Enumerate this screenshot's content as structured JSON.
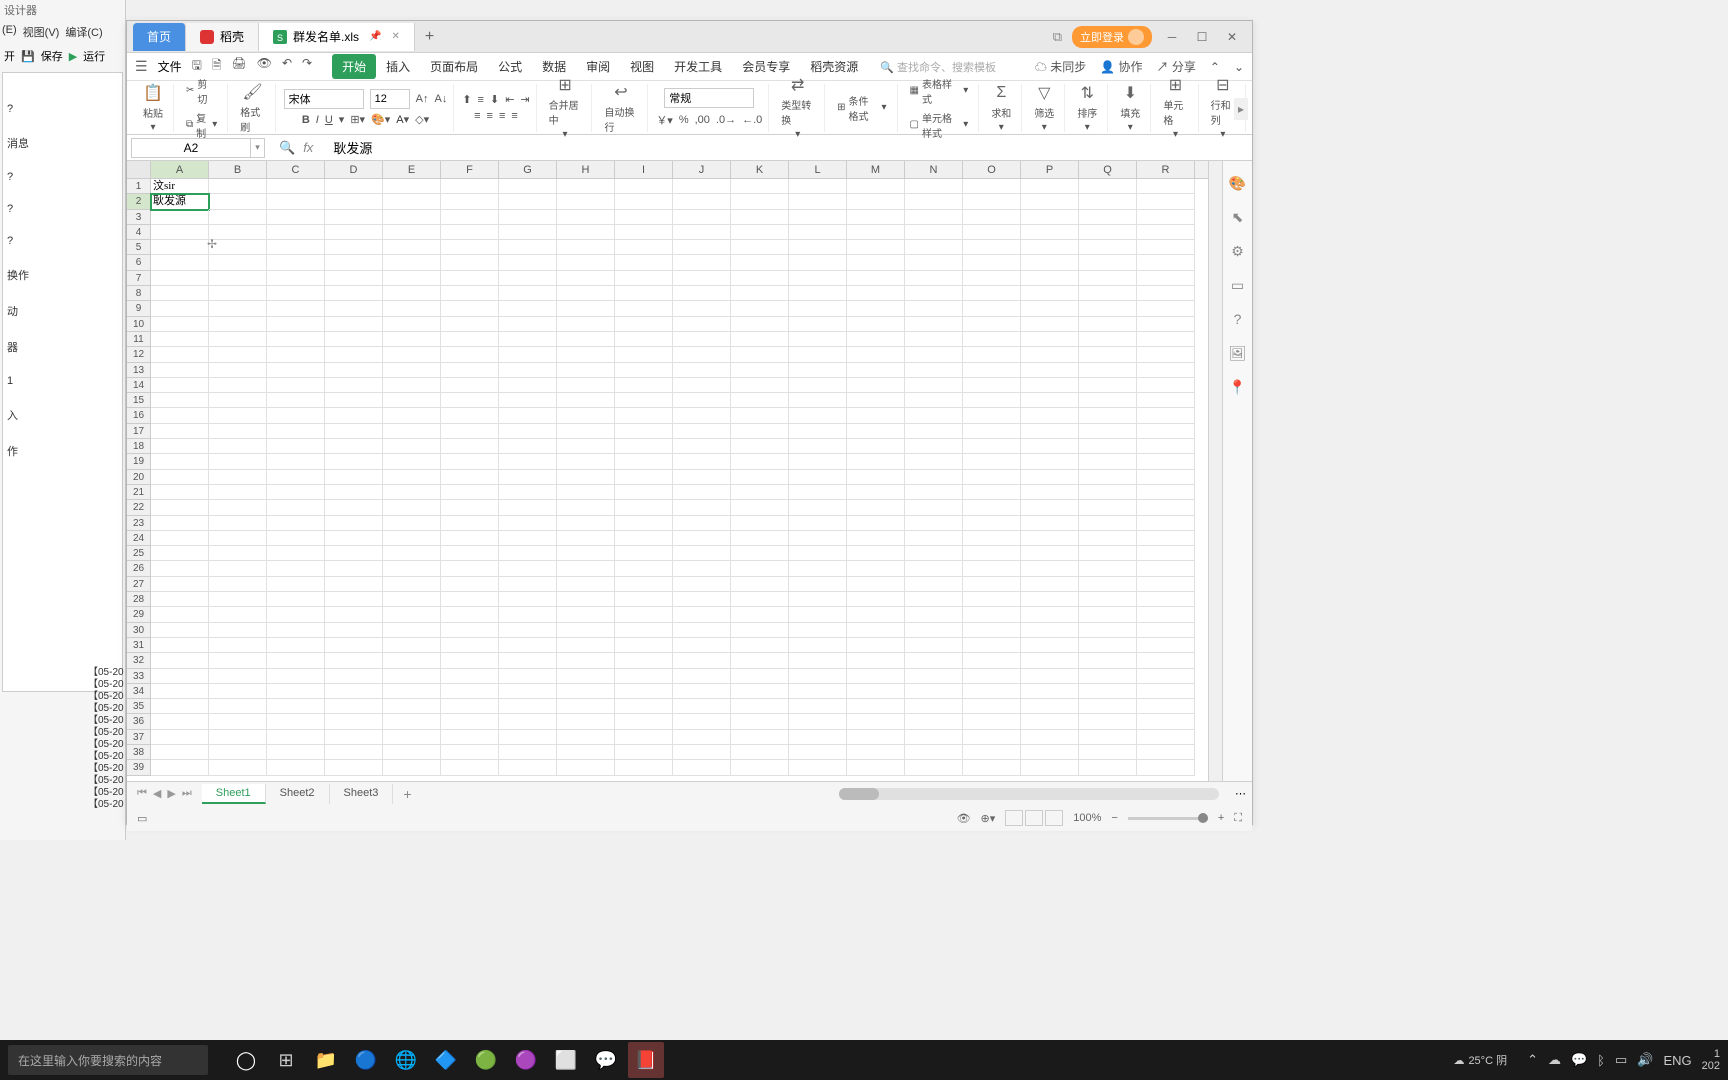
{
  "ide": {
    "title": "设计器",
    "menu": [
      "(E)",
      "视图(V)",
      "编译(C)"
    ],
    "toolbar": {
      "open": "开",
      "save": "保存",
      "run": "运行"
    },
    "tree_items": [
      "?",
      "消息",
      "?",
      "?",
      "?",
      "换作",
      "动",
      "器",
      "1",
      "入",
      "作"
    ],
    "log_lines": [
      "【05-20",
      "【05-20",
      "【05-20",
      "【05-20",
      "【05-20",
      "【05-20",
      "【05-20",
      "【05-20",
      "【05-20",
      "【05-20",
      "【05-20",
      "【05-20"
    ]
  },
  "wps": {
    "tabs": {
      "home": "首页",
      "doc1": "稻壳",
      "current": "群发名单.xls"
    },
    "login": "立即登录",
    "menu": {
      "file": "文件",
      "tabs": [
        "开始",
        "插入",
        "页面布局",
        "公式",
        "数据",
        "审阅",
        "视图",
        "开发工具",
        "会员专享",
        "稻壳资源"
      ],
      "search_placeholder": "查找命令、搜索模板",
      "right": {
        "sync": "未同步",
        "collab": "协作",
        "share": "分享"
      }
    },
    "ribbon": {
      "paste": "粘贴",
      "cut": "剪切",
      "copy": "复制",
      "format_painter": "格式刷",
      "font_name": "宋体",
      "font_size": "12",
      "merge": "合并居中",
      "wrap": "自动换行",
      "number_format": "常规",
      "type_convert": "类型转换",
      "cond_format": "条件格式",
      "table_style": "表格样式",
      "cell_style": "单元格样式",
      "sum": "求和",
      "filter": "筛选",
      "sort": "排序",
      "fill": "填充",
      "cell": "单元格",
      "rowcol": "行和列"
    },
    "cell_ref": "A2",
    "formula_value": "耿发源",
    "columns": [
      "A",
      "B",
      "C",
      "D",
      "E",
      "F",
      "G",
      "H",
      "I",
      "J",
      "K",
      "L",
      "M",
      "N",
      "O",
      "P",
      "Q",
      "R"
    ],
    "row_count": 39,
    "selected_col_idx": 0,
    "selected_row": 2,
    "cells": {
      "A1": "汶sir",
      "A2": "耿发源"
    },
    "sheets": [
      "Sheet1",
      "Sheet2",
      "Sheet3"
    ],
    "active_sheet": 0,
    "zoom": "100%"
  },
  "taskbar": {
    "search_placeholder": "在这里输入你要搜索的内容",
    "weather": "25°C 阴",
    "lang": "ENG",
    "time": "1",
    "date": "202"
  }
}
